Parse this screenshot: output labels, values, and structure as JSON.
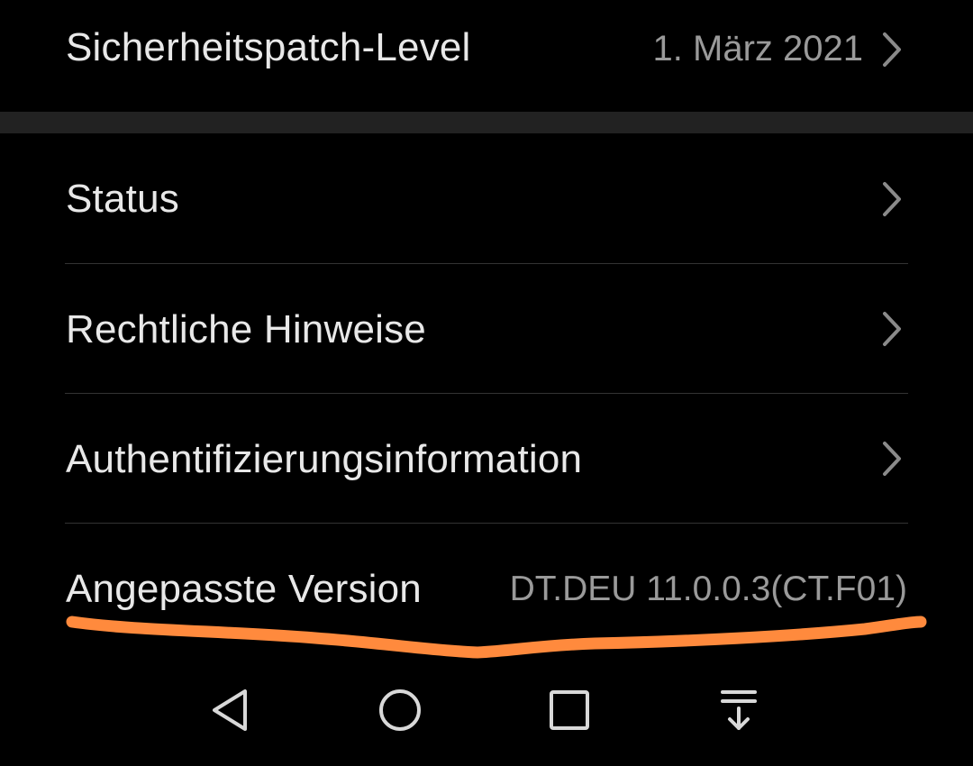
{
  "settings": {
    "security_patch": {
      "label": "Sicherheitspatch-Level",
      "value": "1. März 2021"
    },
    "status": {
      "label": "Status"
    },
    "legal": {
      "label": "Rechtliche Hinweise"
    },
    "auth": {
      "label": "Authentifizierungsinformation"
    },
    "custom_version": {
      "label": "Angepasste Version",
      "value": "DT.DEU 11.0.0.3(CT.F01)"
    }
  },
  "annotation": {
    "underline_color": "#ff8a3d"
  },
  "navbar": {
    "buttons": [
      "back-icon",
      "home-icon",
      "recents-icon",
      "notification-pull-icon"
    ]
  },
  "colors": {
    "background": "#000000",
    "primary_text": "#e8e8e8",
    "secondary_text": "#9a9a9a",
    "section_gap": "#222222",
    "divider": "#333333"
  }
}
